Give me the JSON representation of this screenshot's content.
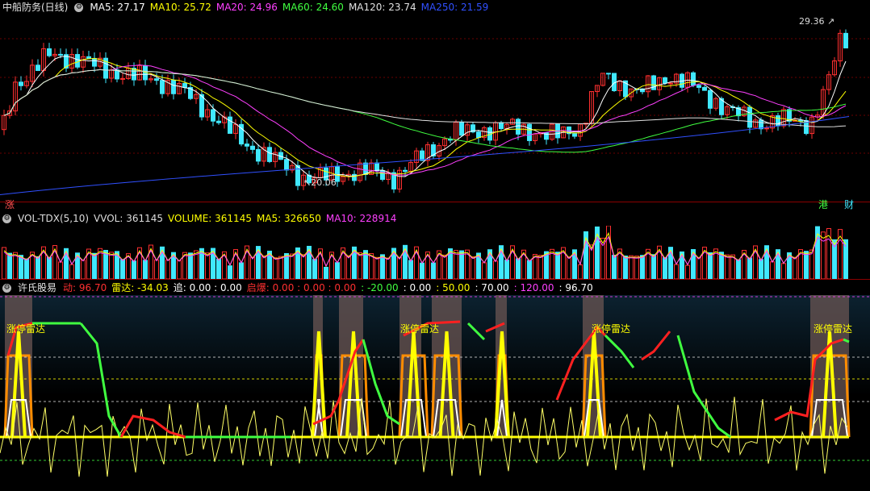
{
  "main": {
    "title": "中船防务(日线)",
    "indicators": [
      {
        "label": "MA5: 27.17",
        "color": "#ffffff"
      },
      {
        "label": "MA10: 25.72",
        "color": "#ffff00"
      },
      {
        "label": "MA20: 24.96",
        "color": "#ff40ff"
      },
      {
        "label": "MA60: 24.60",
        "color": "#40ff40"
      },
      {
        "label": "MA120: 23.74",
        "color": "#e0e0e0"
      },
      {
        "label": "MA250: 21.59",
        "color": "#3050ff"
      }
    ],
    "high_label": "29.36",
    "low_label": "20.06",
    "left_badge": "涨",
    "right_badges": [
      "港",
      "财"
    ]
  },
  "volume": {
    "indicators": [
      {
        "label": "VOL-TDX(5,10)",
        "color": "#dddddd"
      },
      {
        "label": "VVOL: 361145",
        "color": "#dddddd"
      },
      {
        "label": "VOLUME: 361145",
        "color": "#ffff00"
      },
      {
        "label": "MA5: 326650",
        "color": "#ffff00"
      },
      {
        "label": "MA10: 228914",
        "color": "#ff40ff"
      }
    ]
  },
  "indicator": {
    "name": "许氏股易",
    "values": [
      {
        "label": "动: 96.70",
        "color": "#ff3030"
      },
      {
        "label": "雷达: -34.03",
        "color": "#ffff00"
      },
      {
        "label": "追: 0.00 : 0.00",
        "color": "#ffffff"
      },
      {
        "label": "启爆: 0.00 : 0.00 : 0.00",
        "color": "#ff3030"
      },
      {
        "label": ": -20.00",
        "color": "#40ff40"
      },
      {
        "label": ": 0.00",
        "color": "#ffffff"
      },
      {
        "label": ": 50.00",
        "color": "#ffff00"
      },
      {
        "label": ": 70.00",
        "color": "#ffffff"
      },
      {
        "label": ": 120.00",
        "color": "#ff40ff"
      },
      {
        "label": ": 96.70",
        "color": "#ffffff"
      }
    ],
    "signal_label": "涨停雷达"
  },
  "colors": {
    "up": "#ff3030",
    "down": "#40e8ff",
    "bg": "#000000",
    "grid": "#8b0000"
  }
}
